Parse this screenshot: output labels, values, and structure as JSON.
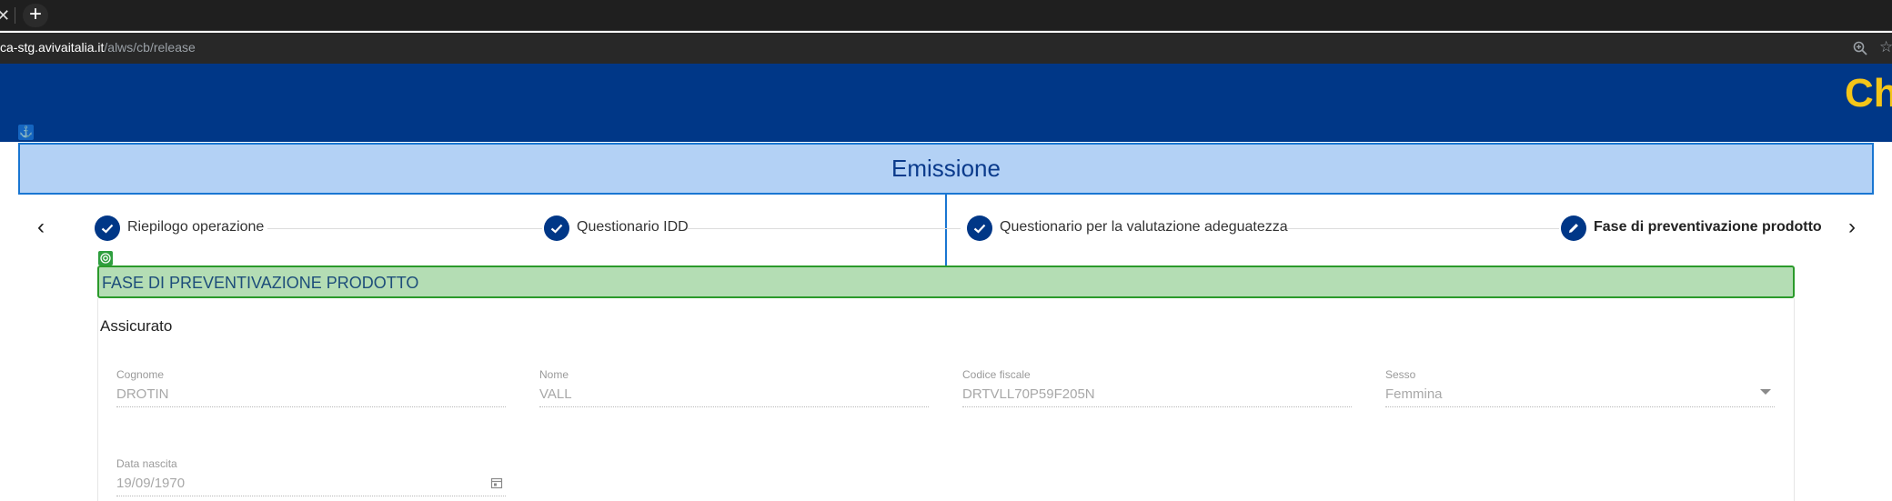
{
  "browser": {
    "tab_close": "✕",
    "new_tab": "+",
    "url_host": "ca-stg.avivaitalia.it",
    "url_path": "/alws/cb/release",
    "star": "☆"
  },
  "header": {
    "partial_text": "Ch"
  },
  "anchor_badge": "⚓",
  "section": {
    "title": "Emissione"
  },
  "stepper": {
    "prev": "‹",
    "next": "›",
    "steps": [
      {
        "label": "Riepilogo operazione",
        "status": "done"
      },
      {
        "label": "Questionario IDD",
        "status": "done"
      },
      {
        "label": "Questionario per la valutazione adeguatezza",
        "status": "done"
      },
      {
        "label": "Fase di preventivazione prodotto",
        "status": "active"
      }
    ]
  },
  "phase": {
    "title": "FASE DI PREVENTIVAZIONE PRODOTTO"
  },
  "insured": {
    "title": "Assicurato",
    "fields": {
      "cognome": {
        "label": "Cognome",
        "value": "DROTIN"
      },
      "nome": {
        "label": "Nome",
        "value": "VALL"
      },
      "codice_fiscale": {
        "label": "Codice fiscale",
        "value": "DRTVLL70P59F205N"
      },
      "sesso": {
        "label": "Sesso",
        "value": "Femmina"
      },
      "data_nascita": {
        "label": "Data nascita",
        "value": "19/09/1970"
      }
    }
  },
  "colors": {
    "header_bg": "#003787",
    "accent_yellow": "#f5c518",
    "section_bg": "#b3d1f5",
    "section_border": "#1976d2",
    "phase_bg": "#b4ddb4",
    "phase_border": "#2a9a2a",
    "step_done": "#003787"
  }
}
